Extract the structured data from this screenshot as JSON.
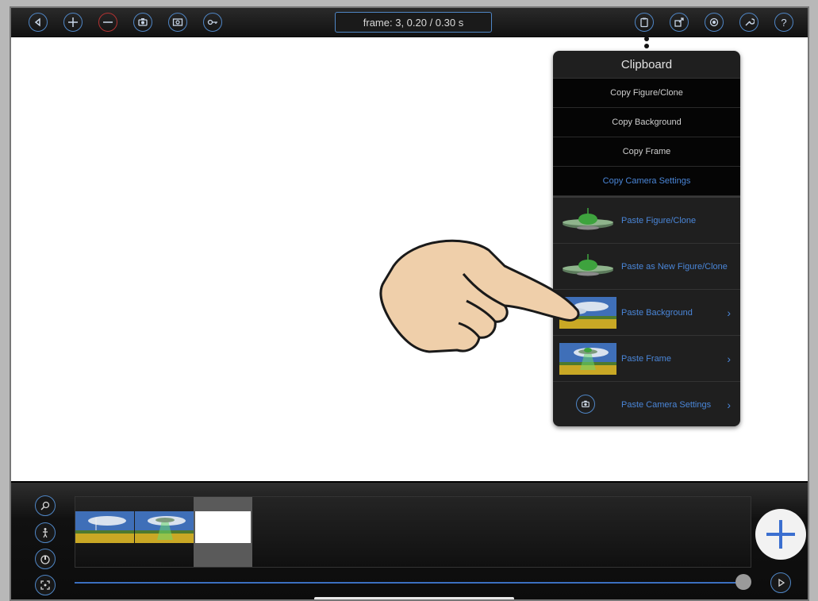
{
  "toolbar": {
    "frame_readout": "frame: 3, 0.20 / 0.30 s",
    "accent_color": "#4f86c6",
    "left_icons": [
      "back-icon",
      "add-icon",
      "remove-icon",
      "camera-icon",
      "screenshot-icon",
      "key-icon"
    ],
    "right_icons": [
      "clipboard-icon",
      "export-icon",
      "settings-icon",
      "wrench-icon",
      "help-icon"
    ],
    "help_label": "?"
  },
  "clipboard": {
    "title": "Clipboard",
    "copy_items": [
      {
        "label": "Copy Figure/Clone"
      },
      {
        "label": "Copy Background"
      },
      {
        "label": "Copy Frame"
      },
      {
        "label": "Copy Camera Settings"
      }
    ],
    "paste_items": [
      {
        "label": "Paste Figure/Clone",
        "thumb": "ufo",
        "chevron": false
      },
      {
        "label": "Paste as New Figure/Clone",
        "thumb": "ufo",
        "chevron": false
      },
      {
        "label": "Paste Background",
        "thumb": "landscape",
        "chevron": true
      },
      {
        "label": "Paste Frame",
        "thumb": "landscape-ufo",
        "chevron": true
      },
      {
        "label": "Paste Camera Settings",
        "thumb": "camera-icon",
        "chevron": true
      }
    ],
    "chevron": "›",
    "link_color": "#4a86d8"
  },
  "timeline": {
    "side_icons": [
      "zoom-icon",
      "figure-icon",
      "onion-skin-icon",
      "fit-icon"
    ],
    "frames": [
      "landscape",
      "landscape-ufo",
      "blank"
    ],
    "current_frame": 3,
    "scrub_position": 1.0,
    "add_icon": "plus-icon",
    "play_icon": "play-icon"
  }
}
